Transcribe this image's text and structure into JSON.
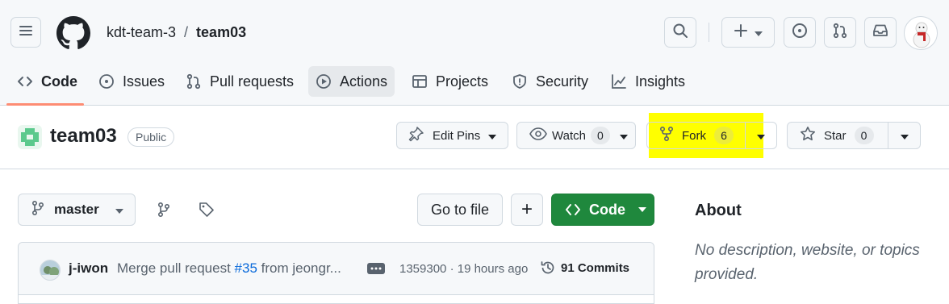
{
  "header": {
    "owner": "kdt-team-3",
    "separator": "/",
    "repo": "team03"
  },
  "tabs": [
    {
      "label": "Code",
      "icon": "code-icon"
    },
    {
      "label": "Issues",
      "icon": "issue-opened-icon"
    },
    {
      "label": "Pull requests",
      "icon": "git-pull-request-icon"
    },
    {
      "label": "Actions",
      "icon": "play-icon"
    },
    {
      "label": "Projects",
      "icon": "table-icon"
    },
    {
      "label": "Security",
      "icon": "shield-icon"
    },
    {
      "label": "Insights",
      "icon": "graph-icon"
    }
  ],
  "repo": {
    "name": "team03",
    "visibility": "Public",
    "edit_pins_label": "Edit Pins",
    "watch_label": "Watch",
    "watch_count": "0",
    "fork_label": "Fork",
    "fork_count": "6",
    "star_label": "Star",
    "star_count": "0",
    "highlight_color": "#ffff00"
  },
  "main": {
    "branch": "master",
    "go_to_file_label": "Go to file",
    "add_label": "+",
    "code_button_label": "Code",
    "code_button_color": "#1f883d"
  },
  "commit": {
    "author": "j-iwon",
    "message_prefix": "Merge pull request ",
    "pr_link": "#35",
    "message_suffix": " from jeongr...",
    "hash_time": "1359300 · 19 hours ago",
    "commits_label": "91 Commits"
  },
  "about": {
    "title": "About",
    "description": "No description, website, or topics provided."
  }
}
